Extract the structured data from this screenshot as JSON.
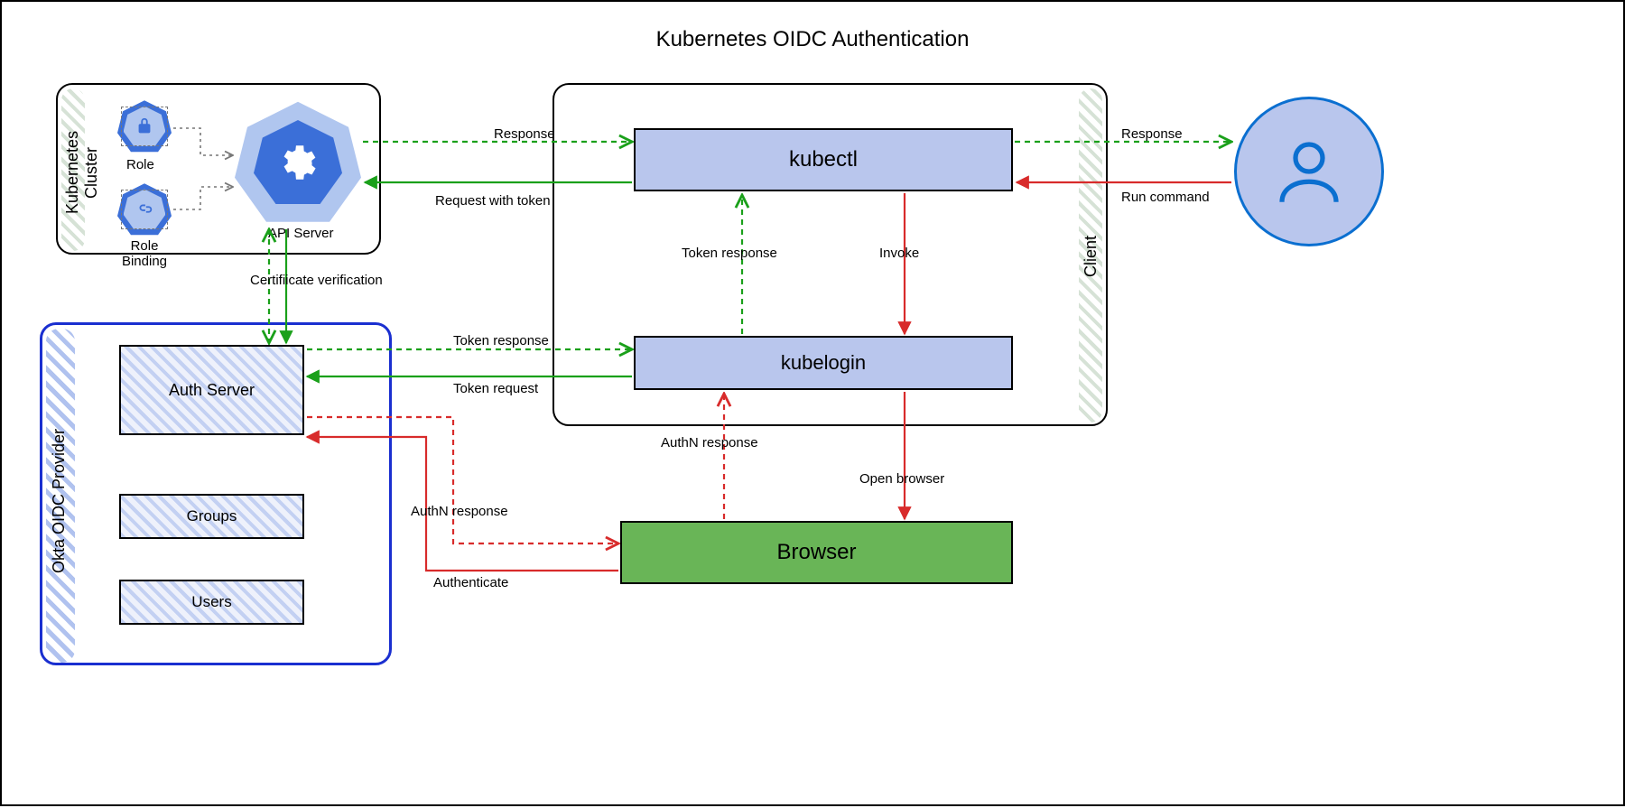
{
  "title": "Kubernetes OIDC Authentication",
  "containers": {
    "k8s_cluster": {
      "label": "Kubernetes Cluster"
    },
    "client": {
      "label": "Client"
    },
    "okta": {
      "label": "Okta OIDC Provider"
    }
  },
  "nodes": {
    "role": {
      "label": "Role",
      "icon": "lock"
    },
    "role_binding": {
      "label": "Role Binding",
      "icon": "link"
    },
    "api_server": {
      "label": "API Server",
      "icon": "gears"
    },
    "kubectl": {
      "label": "kubectl"
    },
    "kubelogin": {
      "label": "kubelogin"
    },
    "browser": {
      "label": "Browser"
    },
    "auth_server": {
      "label": "Auth Server"
    },
    "groups": {
      "label": "Groups"
    },
    "users": {
      "label": "Users"
    },
    "user": {
      "label": "User",
      "icon": "person"
    }
  },
  "edges": {
    "user_to_kubectl": {
      "label": "Run command",
      "style": "red-solid"
    },
    "kubectl_to_user": {
      "label": "Response",
      "style": "green-dashed"
    },
    "kubectl_to_api": {
      "label": "Request with token",
      "style": "green-solid"
    },
    "api_to_kubectl": {
      "label": "Response",
      "style": "green-dashed"
    },
    "kubectl_to_kubelogin": {
      "label": "Invoke",
      "style": "red-solid"
    },
    "kubelogin_to_kubectl": {
      "label": "Token response",
      "style": "green-dashed"
    },
    "kubelogin_to_browser": {
      "label": "Open browser",
      "style": "red-solid"
    },
    "browser_to_kubelogin": {
      "label": "AuthN response",
      "style": "red-dashed"
    },
    "browser_to_auth": {
      "label": "Authenticate",
      "style": "red-solid"
    },
    "auth_to_browser": {
      "label": "AuthN response",
      "style": "red-dashed"
    },
    "kubelogin_to_auth": {
      "label": "Token request",
      "style": "green-solid"
    },
    "auth_to_kubelogin": {
      "label": "Token response",
      "style": "green-dashed"
    },
    "api_to_auth": {
      "label": "Certifiicate verification",
      "style": "green-both"
    },
    "role_to_api": {
      "style": "grey-dashed"
    },
    "rolebinding_to_api": {
      "style": "grey-dashed"
    }
  },
  "colors": {
    "green": "#1aa01a",
    "red": "#d82b2b",
    "blue_accent": "#3b6fd8",
    "okta_border": "#1a2fd0",
    "browser_fill": "#69b557",
    "box_blue": "#b9c6ed"
  }
}
